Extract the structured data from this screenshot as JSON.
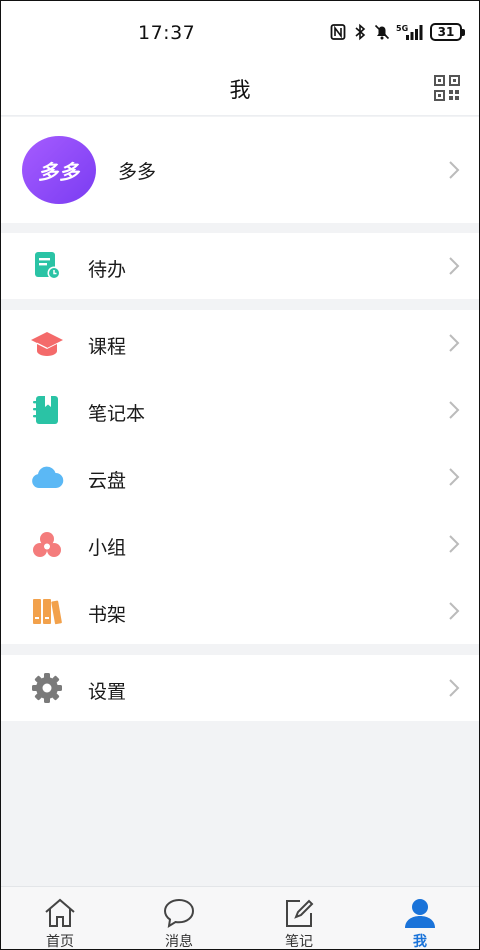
{
  "status_bar": {
    "time": "17:37",
    "network": "5G",
    "battery": "31",
    "icons": [
      "nfc-icon",
      "bluetooth-icon",
      "mute-icon",
      "signal-icon",
      "battery-icon"
    ]
  },
  "header": {
    "title": "我",
    "qr_icon": "qr-code-icon"
  },
  "profile": {
    "avatar_text": "多多",
    "name": "多多",
    "avatar_color": "#8f4cf7"
  },
  "sections": [
    {
      "items": [
        {
          "label": "待办",
          "icon": "todo-icon",
          "color": "#2ac3a5"
        }
      ]
    },
    {
      "items": [
        {
          "label": "课程",
          "icon": "course-icon",
          "color": "#f46a6a"
        },
        {
          "label": "笔记本",
          "icon": "notebook-icon",
          "color": "#2ac3a5"
        },
        {
          "label": "云盘",
          "icon": "cloud-icon",
          "color": "#5bb8f5"
        },
        {
          "label": "小组",
          "icon": "group-icon",
          "color": "#f47c7c"
        },
        {
          "label": "书架",
          "icon": "bookshelf-icon",
          "color": "#f2a14b"
        }
      ]
    },
    {
      "items": [
        {
          "label": "设置",
          "icon": "settings-icon",
          "color": "#7a7a7a"
        }
      ]
    }
  ],
  "tabbar": {
    "tabs": [
      {
        "label": "首页",
        "icon": "home-icon",
        "active": false
      },
      {
        "label": "消息",
        "icon": "message-icon",
        "active": false
      },
      {
        "label": "笔记",
        "icon": "note-edit-icon",
        "active": false
      },
      {
        "label": "我",
        "icon": "profile-icon",
        "active": true
      }
    ],
    "active_color": "#1a73d9"
  }
}
